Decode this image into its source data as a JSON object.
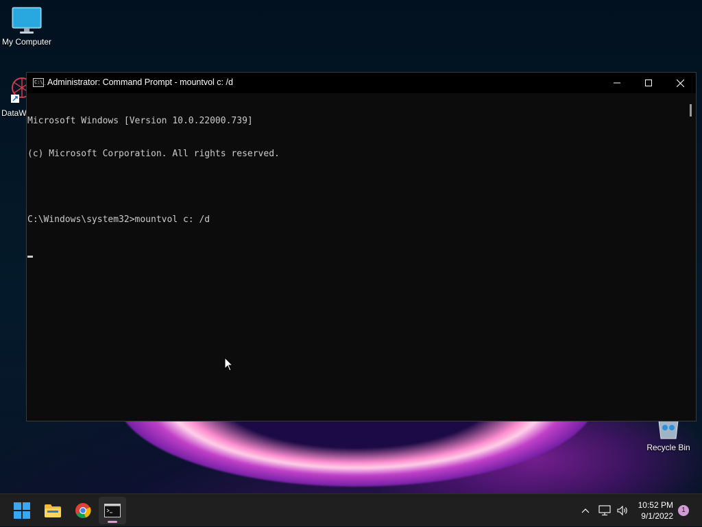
{
  "desktop": {
    "icons": [
      {
        "label": "My Computer",
        "icon": "monitor-icon"
      },
      {
        "label": "DataW",
        "icon": "datawrapper-shortcut-icon"
      },
      {
        "label": "Recycle Bin",
        "icon": "recycle-bin-icon"
      }
    ]
  },
  "window": {
    "title": "Administrator: Command Prompt - mountvol  c: /d",
    "app_icon_text": "C:\\_",
    "controls": {
      "minimize": "minimize-icon",
      "maximize": "maximize-icon",
      "close": "close-icon"
    },
    "console_lines": [
      "Microsoft Windows [Version 10.0.22000.739]",
      "(c) Microsoft Corporation. All rights reserved.",
      "",
      "C:\\Windows\\system32>mountvol c: /d"
    ]
  },
  "taskbar": {
    "apps": [
      {
        "name": "start",
        "icon": "windows-start-icon",
        "active": false
      },
      {
        "name": "file-explorer",
        "icon": "folder-icon",
        "active": false
      },
      {
        "name": "chrome",
        "icon": "chrome-icon",
        "active": false
      },
      {
        "name": "command-prompt",
        "icon": "terminal-icon",
        "active": true
      }
    ],
    "tray": {
      "chevron": "chevron-up-icon",
      "network": "network-icon",
      "volume": "speaker-icon"
    },
    "clock": {
      "time": "10:52 PM",
      "date": "9/1/2022"
    },
    "notification_count": "1"
  },
  "colors": {
    "console_bg": "#0c0c0c",
    "console_text": "#cccccc",
    "taskbar_bg": "#1f1f1f",
    "notification_badge": "#d39bd6"
  }
}
